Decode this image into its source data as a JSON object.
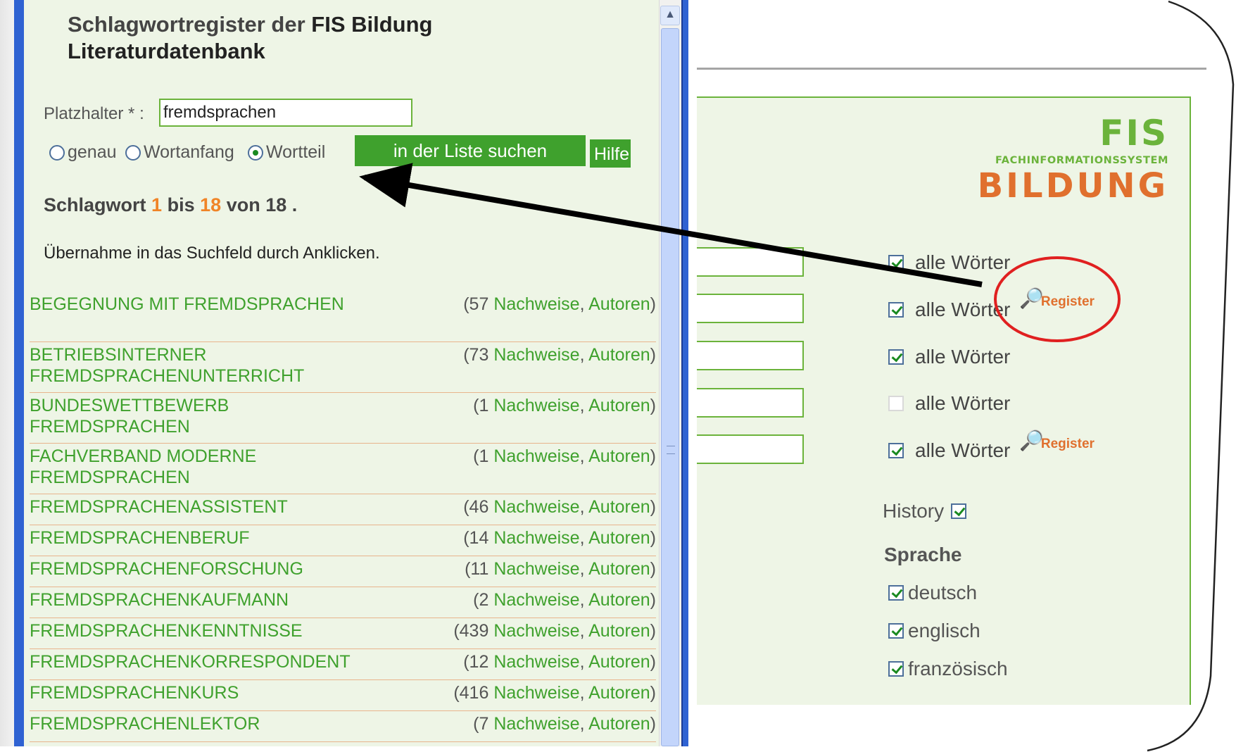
{
  "popup": {
    "title_prefix": "Schlagwortregister der ",
    "title_strong": "FIS Bildung",
    "title_line2": "Literaturdatenbank",
    "placeholder_label": "Platzhalter * :",
    "placeholder_value": "fremdsprachen",
    "radio_options": [
      {
        "label": "genau",
        "selected": false
      },
      {
        "label": "Wortanfang",
        "selected": false
      },
      {
        "label": "Wortteil",
        "selected": true
      }
    ],
    "search_button": "in der Liste suchen",
    "help_button": "Hilfe",
    "result_text": {
      "prefix": "Schlagwort",
      "from": "1",
      "mid": "bis",
      "to": "18",
      "of_label": "von 18 ."
    },
    "instruction": "Übernahme in das Suchfeld durch Anklicken.",
    "keywords": [
      {
        "term": "BEGEGNUNG MIT FREMDSPRACHEN",
        "count": "57"
      },
      {
        "term": "BETRIEBSINTERNER FREMDSPRACHENUNTERRICHT",
        "count": "73"
      },
      {
        "term": "BUNDESWETTBEWERB FREMDSPRACHEN",
        "count": "1"
      },
      {
        "term": "FACHVERBAND MODERNE FREMDSPRACHEN",
        "count": "1"
      },
      {
        "term": "FREMDSPRACHENASSISTENT",
        "count": "46"
      },
      {
        "term": "FREMDSPRACHENBERUF",
        "count": "14"
      },
      {
        "term": "FREMDSPRACHENFORSCHUNG",
        "count": "11"
      },
      {
        "term": "FREMDSPRACHENKAUFMANN",
        "count": "2"
      },
      {
        "term": "FREMDSPRACHENKENNTNISSE",
        "count": "439"
      },
      {
        "term": "FREMDSPRACHENKORRESPONDENT",
        "count": "12"
      },
      {
        "term": "FREMDSPRACHENKURS",
        "count": "416"
      },
      {
        "term": "FREMDSPRACHENLEKTOR",
        "count": "7"
      }
    ],
    "link_nachweise": "Nachweise",
    "link_autoren": "Autoren"
  },
  "background": {
    "logo": {
      "fis": "FIS",
      "sub": "FACHINFORMATIONSSYSTEM",
      "bildung": "BILDUNG"
    },
    "all_words_label": "alle Wörter",
    "all_words_rows": [
      {
        "checked": true,
        "register": false
      },
      {
        "checked": true,
        "register": true
      },
      {
        "checked": true,
        "register": false
      },
      {
        "checked": false,
        "register": false
      },
      {
        "checked": true,
        "register": true
      }
    ],
    "register_label": "Register",
    "history_label": "History",
    "history_checked": true,
    "language_heading": "Sprache",
    "languages": [
      {
        "label": "deutsch",
        "checked": true
      },
      {
        "label": "englisch",
        "checked": true
      },
      {
        "label": "französisch",
        "checked": true
      }
    ]
  },
  "colors": {
    "accent_green": "#3fa12d",
    "highlight_orange": "#f08427",
    "annotation_red": "#e02020"
  }
}
